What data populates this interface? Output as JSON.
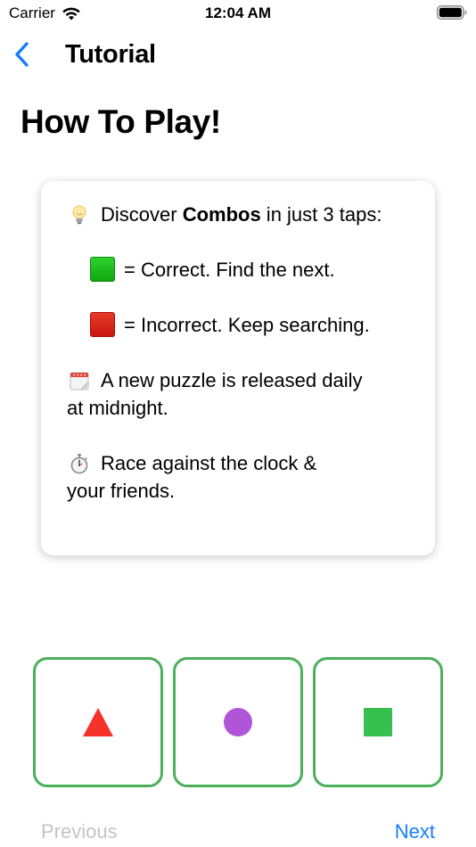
{
  "status_bar": {
    "carrier": "Carrier",
    "time": "12:04 AM",
    "wifi_icon": "wifi-icon",
    "battery_icon": "battery-icon"
  },
  "nav": {
    "back_icon": "chevron-left-icon",
    "title": "Tutorial"
  },
  "page": {
    "title": "How To Play!"
  },
  "card": {
    "combos_prefix": "Discover ",
    "combos_bold": "Combos",
    "combos_suffix": " in just 3 taps:",
    "correct_text": "= Correct. Find the next.",
    "incorrect_text": "= Incorrect. Keep searching.",
    "puzzle_line1": "A new puzzle is released daily",
    "puzzle_line2": "at midnight.",
    "race_line1": "Race against the clock &",
    "race_line2": "your friends.",
    "icons": [
      "lightbulb-icon",
      "green-square-icon",
      "red-square-icon",
      "calendar-icon",
      "stopwatch-icon"
    ]
  },
  "tiles": [
    {
      "shape": "triangle",
      "color": "#f5332b"
    },
    {
      "shape": "circle",
      "color": "#b055d8"
    },
    {
      "shape": "square",
      "color": "#35c04f"
    }
  ],
  "tile_border_color": "#4caf5a",
  "footer": {
    "previous_label": "Previous",
    "next_label": "Next"
  },
  "colors": {
    "accent": "#147efb",
    "disabled": "#c4c4c6"
  }
}
